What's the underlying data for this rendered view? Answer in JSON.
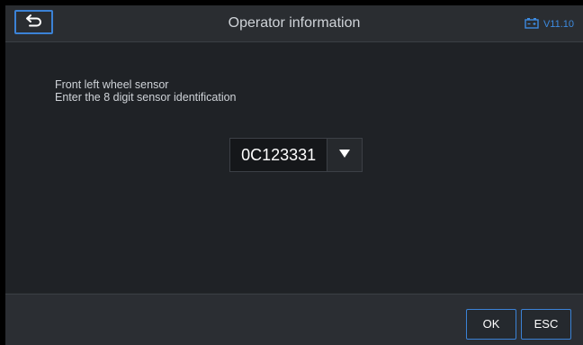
{
  "header": {
    "title": "Operator information",
    "back_icon": "back-arrow-icon",
    "battery_icon": "battery-icon",
    "version": "V11.10"
  },
  "content": {
    "line1": "Front left wheel sensor",
    "line2": "Enter the 8 digit sensor identification",
    "sensor_id": "0C123331",
    "dropdown_icon": "dropdown-triangle-icon"
  },
  "footer": {
    "ok_label": "OK",
    "esc_label": "ESC"
  },
  "colors": {
    "accent": "#3b82d6",
    "background": "#232629",
    "text": "#cfd3d8"
  }
}
